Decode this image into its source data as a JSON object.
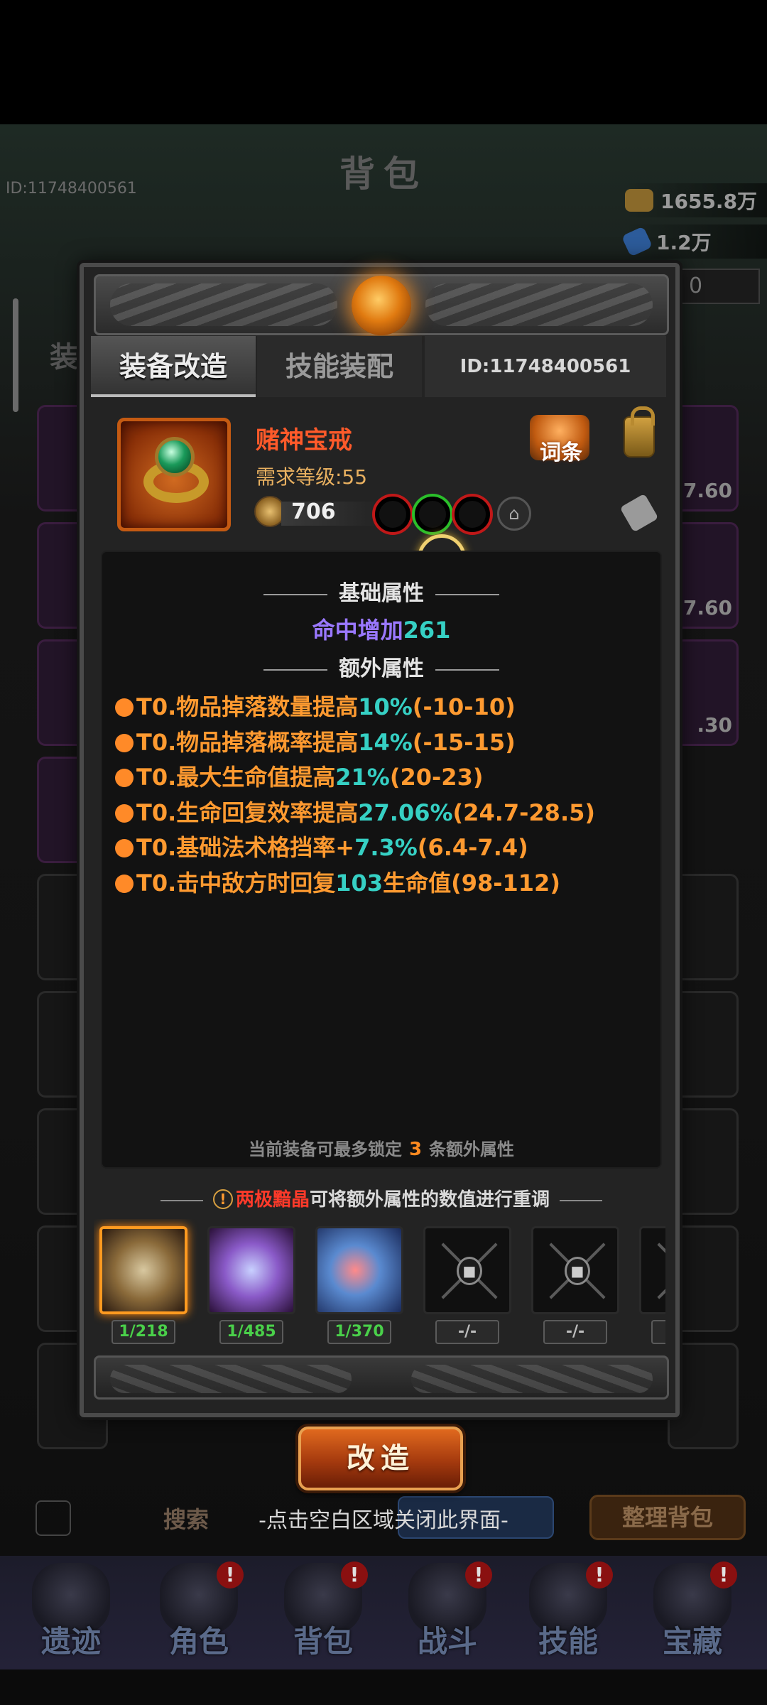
{
  "background": {
    "title": "背包",
    "player_id": "ID:11748400561",
    "gold": "1655.8万",
    "gems": "1.2万",
    "input_value": "0",
    "tab_label": "装",
    "slot_levels": [
      "7.60",
      "7.60",
      ".30"
    ],
    "search_label": "搜索",
    "sort_button": "整理背包",
    "close_hint": "-点击空白区域关闭此界面-"
  },
  "nav": {
    "items": [
      {
        "label": "遗迹",
        "icon": "relic-icon",
        "badge": ""
      },
      {
        "label": "角色",
        "icon": "character-icon",
        "badge": "!"
      },
      {
        "label": "背包",
        "icon": "bag-icon",
        "badge": "!"
      },
      {
        "label": "战斗",
        "icon": "battle-icon",
        "badge": "!"
      },
      {
        "label": "技能",
        "icon": "skill-book-icon",
        "badge": "!"
      },
      {
        "label": "宝藏",
        "icon": "treasure-icon",
        "badge": "!"
      }
    ]
  },
  "panel": {
    "tabs": {
      "reforge": "装备改造",
      "skill_equip": "技能装配"
    },
    "id_label": "ID:11748400561",
    "item": {
      "name": "赌神宝戒",
      "req_level": "需求等级:55",
      "power": "706",
      "sockets": [
        "red",
        "green",
        "red",
        "locked"
      ]
    },
    "entry_button": "词条",
    "sections": {
      "base": "基础属性",
      "extra": "额外属性"
    },
    "base_attr": {
      "label": "命中增加",
      "value": "261"
    },
    "extra_attrs": [
      {
        "prefix": "T0.物品掉落数量提高",
        "value": "10%",
        "range": "(-10-10)"
      },
      {
        "prefix": "T0.物品掉落概率提高",
        "value": "14%",
        "range": "(-15-15)"
      },
      {
        "prefix": "T0.最大生命值提高",
        "value": "21%",
        "range": "(20-23)"
      },
      {
        "prefix": "T0.生命回复效率提高",
        "value": "27.06%",
        "range": "(24.7-28.5)"
      },
      {
        "prefix": "T0.基础法术格挡率+",
        "value": "7.3%",
        "range": "(6.4-7.4)"
      },
      {
        "prefix": "T0.击中敌方时回复",
        "value": "103",
        "suffix": "生命值",
        "range": "(98-112)"
      }
    ],
    "lock_note": {
      "before": "当前装备可最多锁定",
      "count": "3",
      "after": "条额外属性"
    },
    "material_hint": {
      "highlight": "两极黯晶",
      "rest": "可将额外属性的数值进行重调"
    },
    "materials": [
      {
        "name": "yin-yang-crystal",
        "have": "1",
        "need": "/218",
        "locked": false,
        "selected": true
      },
      {
        "name": "purple-geode",
        "have": "1",
        "need": "/485",
        "locked": false,
        "selected": false
      },
      {
        "name": "prism-ore",
        "have": "1",
        "need": "/370",
        "locked": false,
        "selected": false
      },
      {
        "name": "locked-slot",
        "have": "",
        "need": "-/-",
        "locked": true,
        "selected": false
      },
      {
        "name": "locked-slot",
        "have": "",
        "need": "-/-",
        "locked": true,
        "selected": false
      },
      {
        "name": "locked-slot",
        "have": "",
        "need": "",
        "locked": true,
        "selected": false
      }
    ],
    "reforge_button": "改造"
  }
}
